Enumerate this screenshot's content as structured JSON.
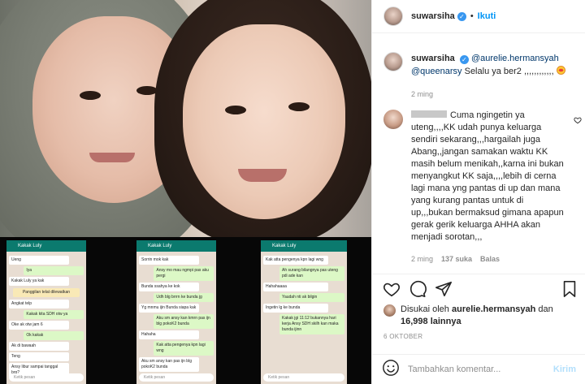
{
  "post": {
    "username": "suwarsiha",
    "follow_label": "Ikuti",
    "separator": "•"
  },
  "caption": {
    "username": "suwarsiha",
    "mention_1": "@aurelie.hermansyah",
    "mention_2": "@queenarsy",
    "text": " Selalu ya ber2 ,,,,,,,,,,,,",
    "time": "2 ming"
  },
  "comment": {
    "text": "Cuma ngingetin ya uteng,,,,KK udah punya keluarga sendiri sekarang,,,hargailah juga Abang,,jangan samakan waktu KK masih belum menikah,,karna ini bukan menyangkut KK saja,,,,lebih di cerna lagi mana yng pantas di up dan mana yang kurang pantas untuk di up,,,bukan bermaksud gimana apapun gerak gerik keluarga AHHA akan menjadi sorotan,,,",
    "time": "2 ming",
    "likes": "137 suka",
    "reply_label": "Balas"
  },
  "likes": {
    "prefix": "Disukai oleh ",
    "user": "aurelie.hermansyah",
    "middle": " dan ",
    "count": "16,998 lainnya"
  },
  "date": "6 OKTOBER",
  "comment_box": {
    "placeholder": "Tambahkan komentar...",
    "post_label": "Kirim"
  },
  "screenshots": [
    {
      "contact": "Kakak Luly",
      "messages": [
        {
          "kind": "in",
          "text": "Ueng"
        },
        {
          "kind": "out",
          "text": "Iya"
        },
        {
          "kind": "in",
          "text": "Kakak Luly ya kak"
        },
        {
          "kind": "sys",
          "text": "Panggilan telat dilewatkan"
        },
        {
          "kind": "in",
          "text": "Angkat telp"
        },
        {
          "kind": "out",
          "text": "Kakak kita SDH otw ya"
        },
        {
          "kind": "in",
          "text": "Oke ak otw jam 6"
        },
        {
          "kind": "out",
          "text": "Ok kakak"
        },
        {
          "kind": "in",
          "text": "Ak di bawaah"
        },
        {
          "kind": "in",
          "text": "Teng"
        },
        {
          "kind": "in",
          "text": "Ansy libur sampai tanggal brp?"
        }
      ],
      "input": "Ketik pesan"
    },
    {
      "contact": "Kakak Luly",
      "messages": [
        {
          "kind": "in",
          "text": "Sorrin mok kak"
        },
        {
          "kind": "out",
          "text": "Ansy mo mau ngmpi pas aku pergi"
        },
        {
          "kind": "in",
          "text": "Bunda ssahya ke kok"
        },
        {
          "kind": "out",
          "text": "Udh blg brrrn ke bunda jg"
        },
        {
          "kind": "in",
          "text": "Yg mnmu ijin Bunda  siapa kak"
        },
        {
          "kind": "out",
          "text": "Aku sm ansy kan kmrn pas ijn blg pokoK2 bunda"
        },
        {
          "kind": "in",
          "text": "Hahaha"
        },
        {
          "kind": "out",
          "text": "Kak atta pengenya kpn lagi wng"
        },
        {
          "kind": "in",
          "text": "Aku sm ansy kan pas ijn blg pokoK2 bunda"
        }
      ],
      "input": "Ketik pesan"
    },
    {
      "contact": "Kakak Luly",
      "messages": [
        {
          "kind": "in",
          "text": "Kak atta pengenya kpn lagi wng"
        },
        {
          "kind": "out",
          "text": "Ah surang bilangnya pas uteng pdi ade kan"
        },
        {
          "kind": "in",
          "text": "Hahahaaaa"
        },
        {
          "kind": "out",
          "text": "Yaudah nti ak bilgin"
        },
        {
          "kind": "in",
          "text": "Ingetin lg ke bunda"
        },
        {
          "kind": "out",
          "text": "Kakak jgi 11:12 bukannya hari kerja Ansy SDH skilh kan maka bunda ijinn"
        }
      ],
      "input": "Ketik pesan"
    }
  ],
  "colors": {
    "accent": "#0095f6",
    "verified": "#3897f0",
    "meta_gray": "#8e8e8e",
    "whatsapp_header": "#0b7a6e"
  }
}
